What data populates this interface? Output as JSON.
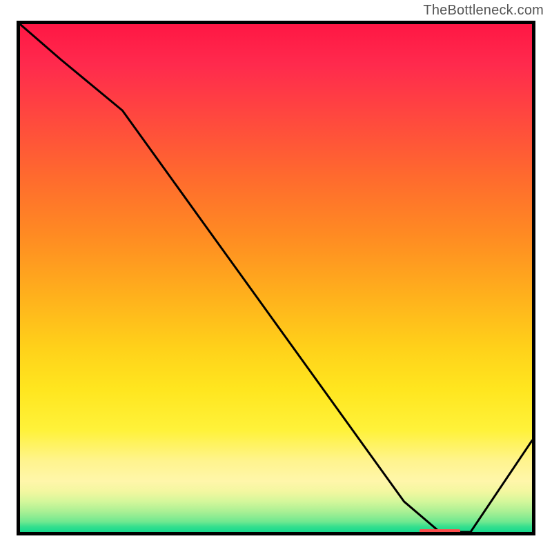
{
  "watermark": "TheBottleneck.com",
  "colors": {
    "border": "#000000",
    "curve": "#000000",
    "marker": "#ff4d4d",
    "gradient_top": "#ff1744",
    "gradient_mid": "#ffd21a",
    "gradient_bottom": "#17d98d"
  },
  "chart_data": {
    "type": "line",
    "title": "",
    "xlabel": "",
    "ylabel": "",
    "xlim": [
      0,
      100
    ],
    "ylim": [
      0,
      100
    ],
    "grid": false,
    "legend": false,
    "series": [
      {
        "name": "curve",
        "x": [
          0,
          8,
          20,
          35,
          50,
          65,
          75,
          82,
          88,
          100
        ],
        "values": [
          100,
          93,
          83,
          62,
          41,
          20,
          6,
          0,
          0,
          18
        ]
      }
    ],
    "marker": {
      "x": 82,
      "y": 0,
      "width": 8
    },
    "annotations": []
  }
}
